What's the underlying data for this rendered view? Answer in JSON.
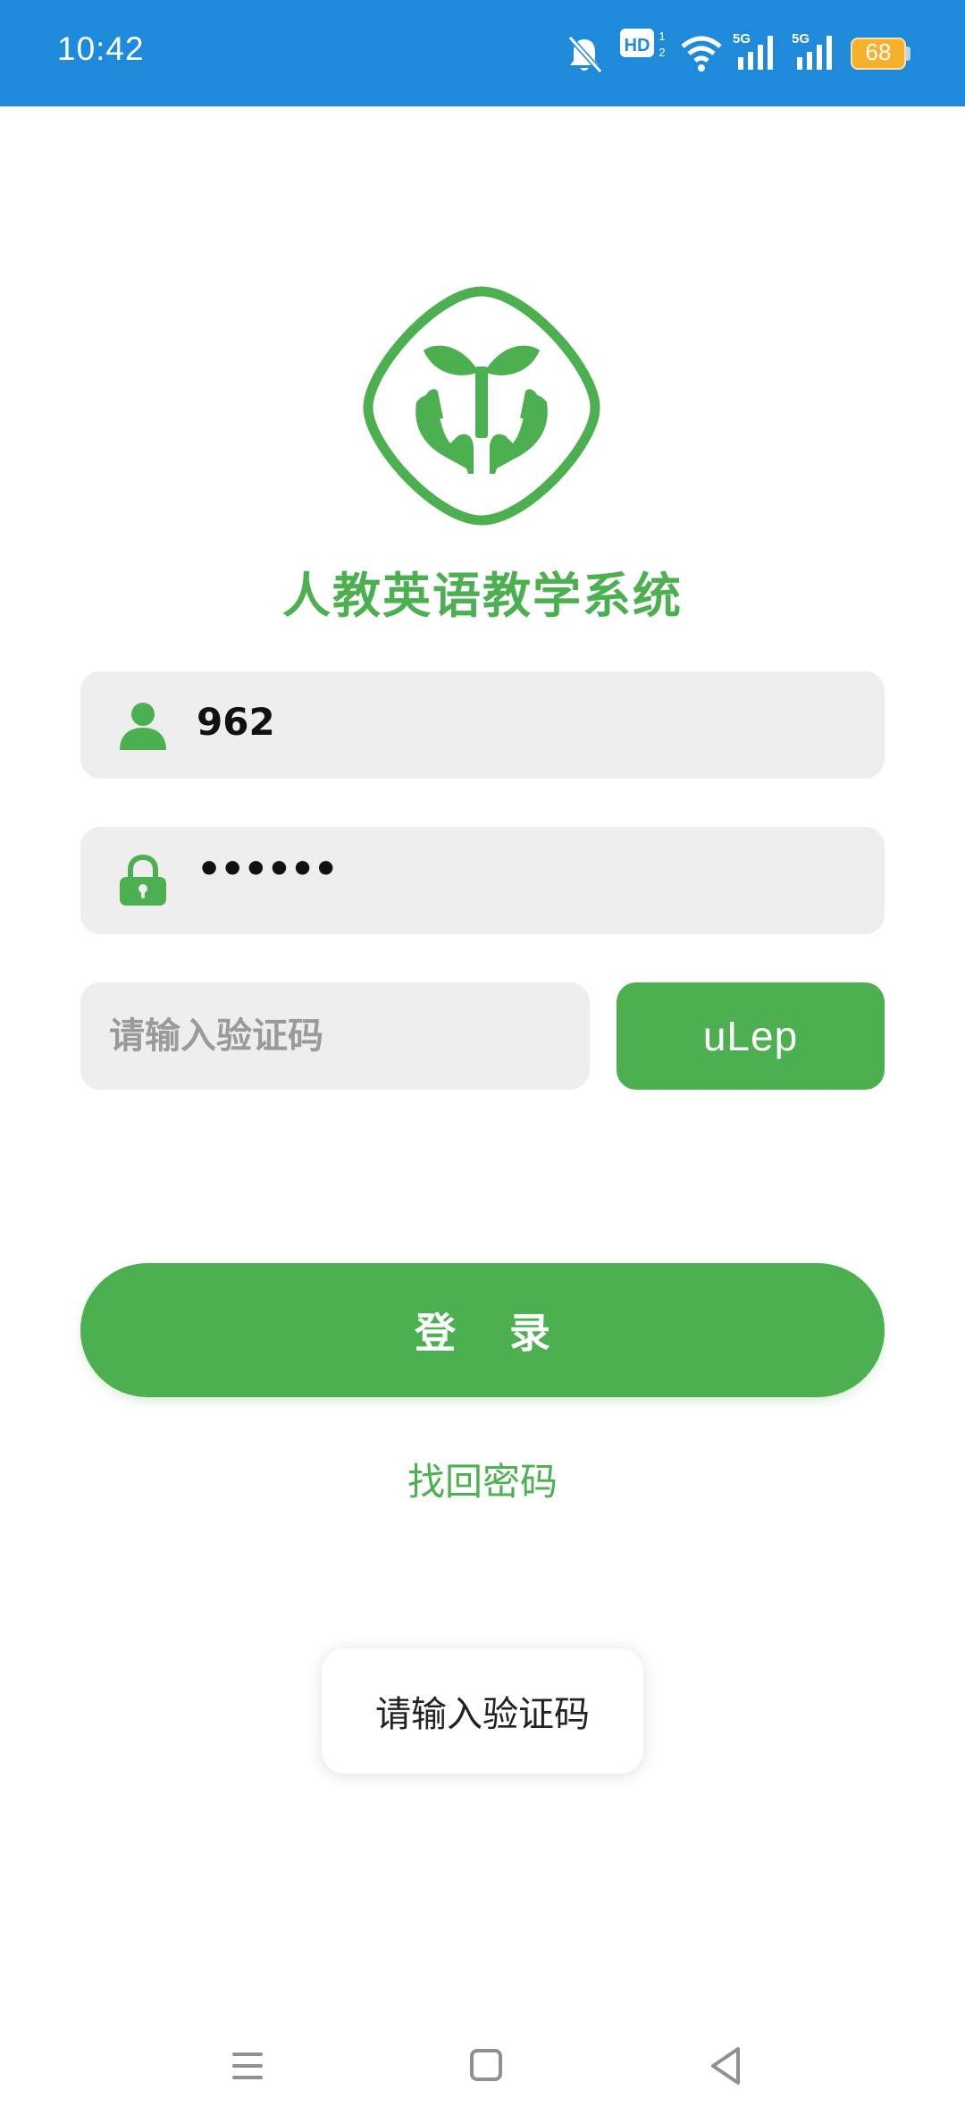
{
  "status_bar": {
    "time": "10:42",
    "battery_level": "68",
    "network_labels": [
      "HD",
      "5G",
      "5G"
    ],
    "colors": {
      "background": "#1e8ad9",
      "battery": "#f7b02c"
    }
  },
  "app": {
    "title": "人教英语教学系统",
    "logo_icon": "sprout-in-hands-logo",
    "accent_color": "#4caf50"
  },
  "login_form": {
    "username": {
      "icon": "user-icon",
      "value": "962"
    },
    "password": {
      "icon": "lock-icon",
      "masked_value": "••••••"
    },
    "captcha": {
      "placeholder": "请输入验证码",
      "value": "",
      "code_button_label": "uLep"
    },
    "login_button_label": "登 录",
    "forgot_password_label": "找回密码"
  },
  "toast": {
    "message": "请输入验证码"
  },
  "navigation_bar": {
    "items": [
      "menu-icon",
      "home-icon",
      "back-icon"
    ]
  }
}
